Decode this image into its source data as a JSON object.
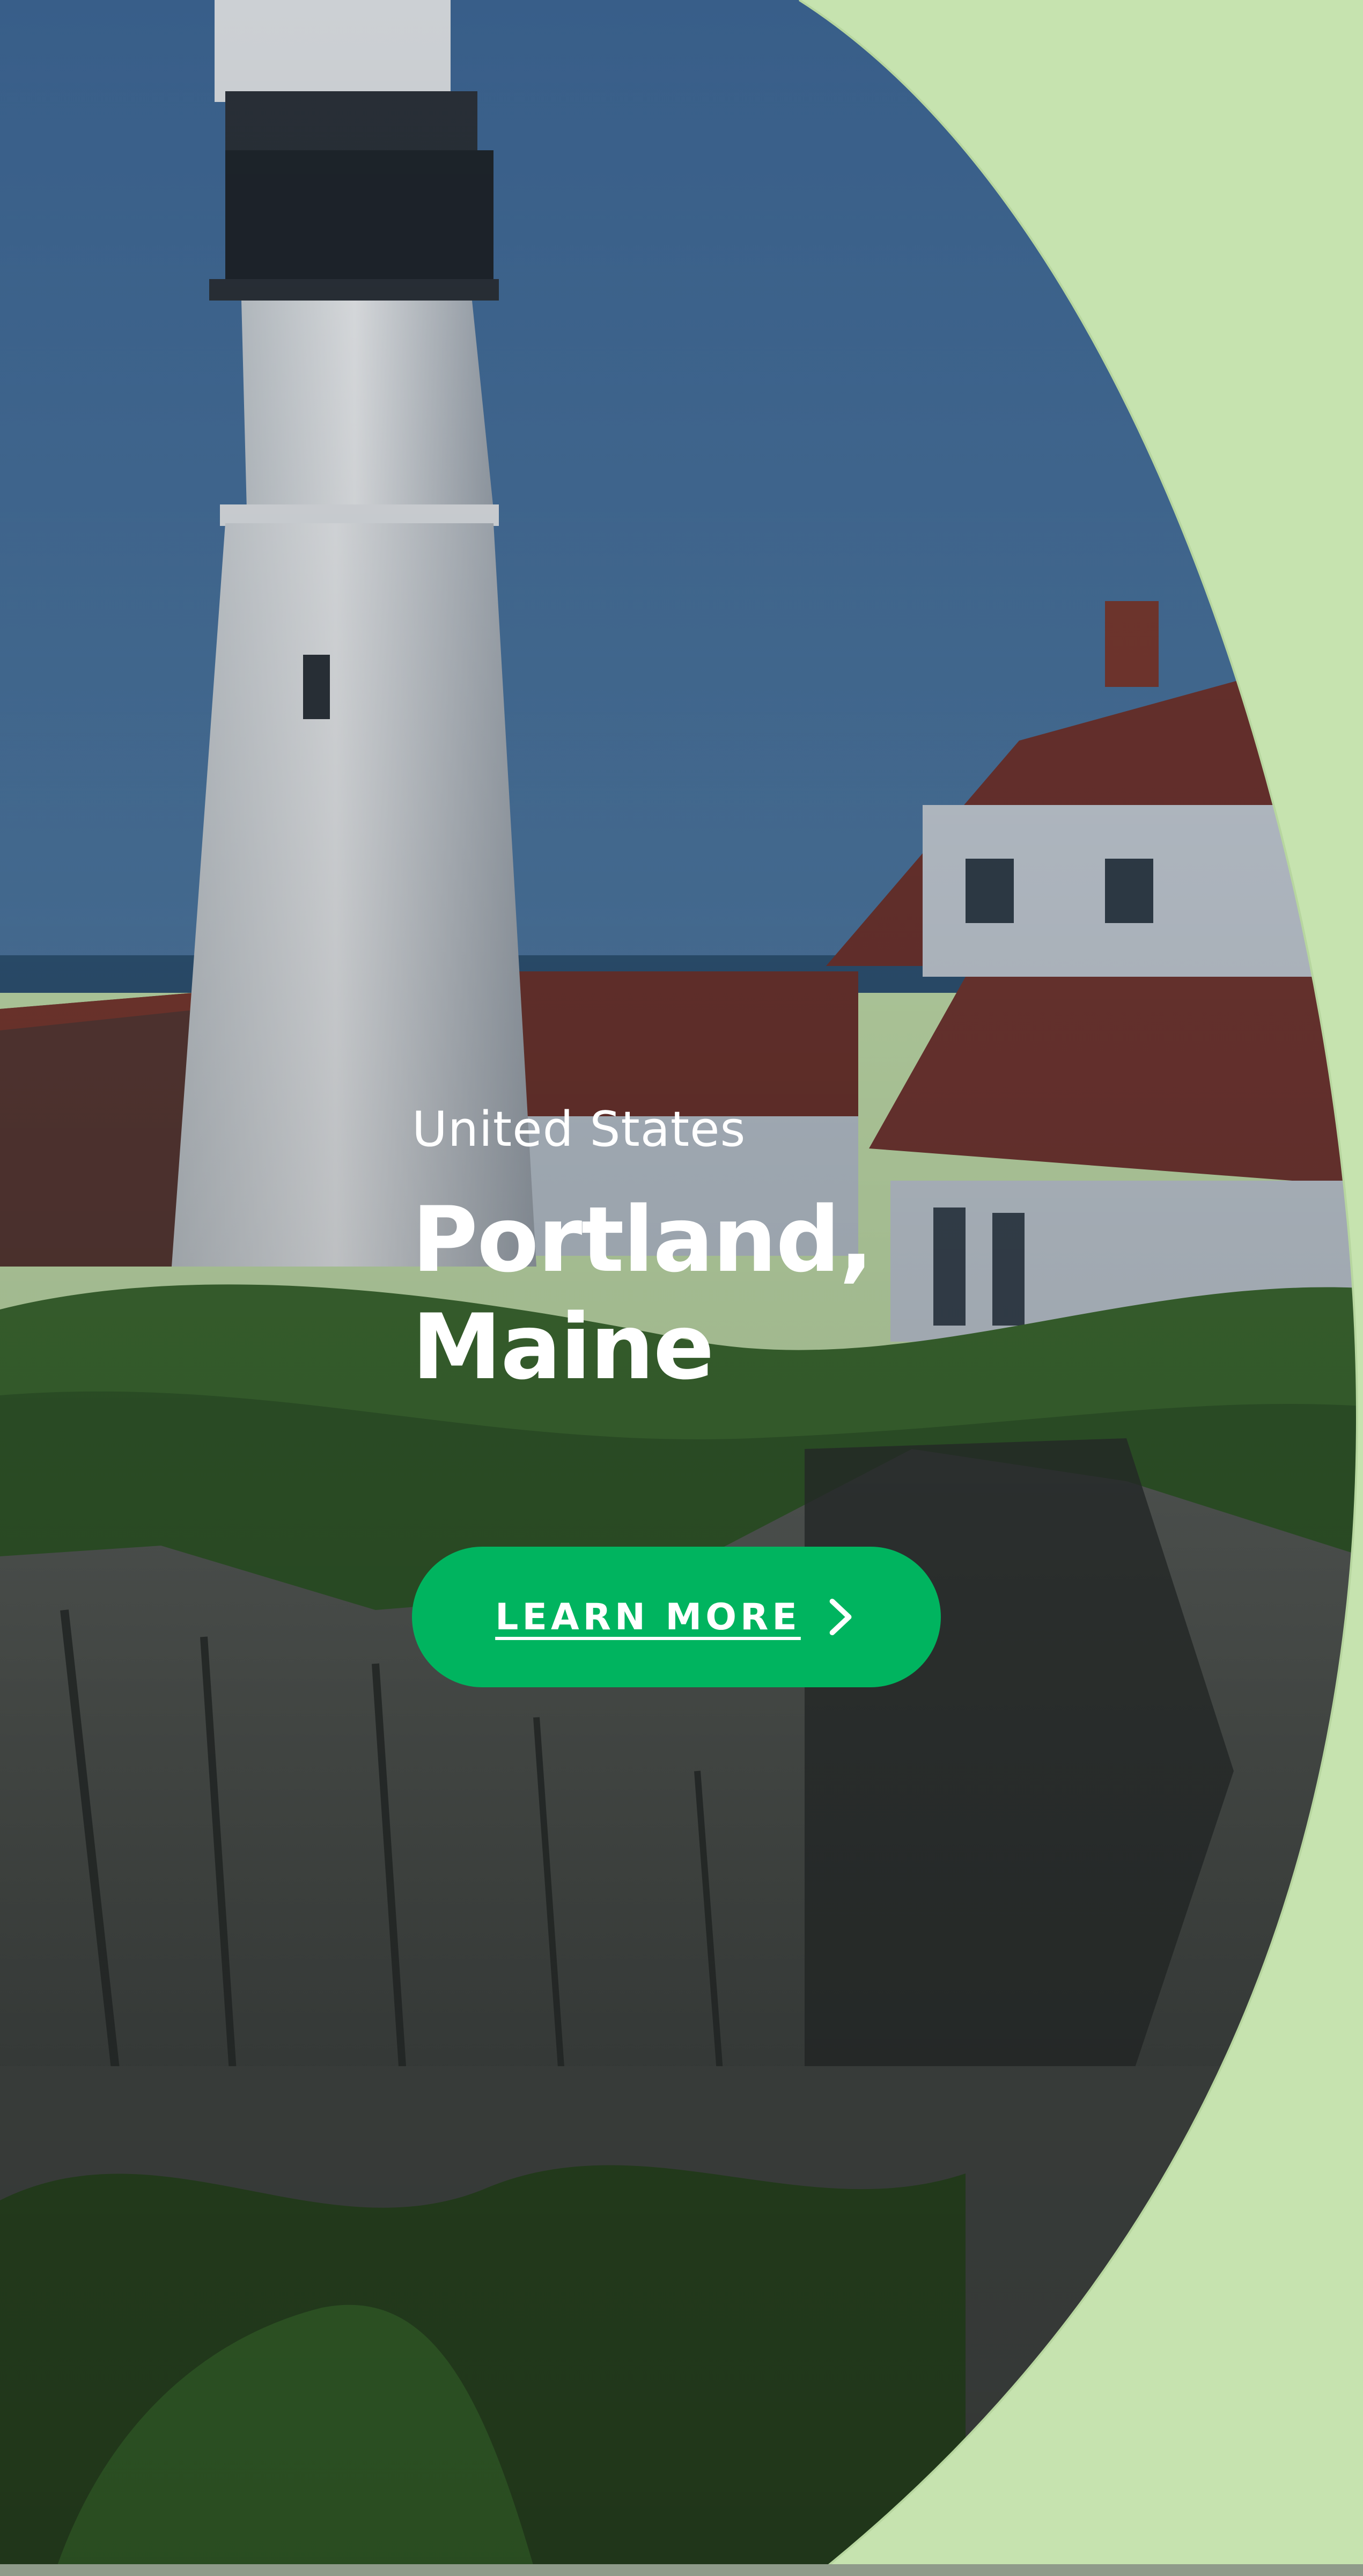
{
  "hero": {
    "eyebrow": "United States",
    "title_line1": "Portland,",
    "title_line2": "Maine",
    "image_subject": "lighthouse-coastal-cliff-photo"
  },
  "cta": {
    "label": "LEARN MORE",
    "icon": "chevron-right-icon"
  },
  "colors": {
    "background": "#c6e3af",
    "accent": "#00b45f",
    "sky": "#3e6a96",
    "text": "#ffffff"
  }
}
